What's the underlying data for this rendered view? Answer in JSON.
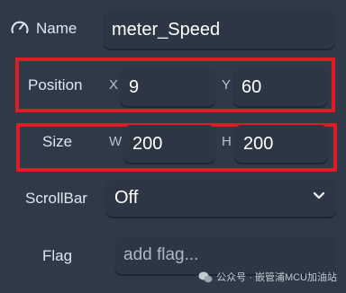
{
  "name": {
    "label": "Name",
    "value": "meter_Speed",
    "icon": "speedometer-icon"
  },
  "position": {
    "label": "Position",
    "x_label": "X",
    "x_value": "9",
    "y_label": "Y",
    "y_value": "60"
  },
  "size": {
    "label": "Size",
    "w_label": "W",
    "w_value": "200",
    "h_label": "H",
    "h_value": "200"
  },
  "scrollbar": {
    "label": "ScrollBar",
    "value": "Off",
    "icon": "chevron-down-icon"
  },
  "flag": {
    "label": "Flag",
    "placeholder": "add flag..."
  },
  "watermark": {
    "text": "公众号 · 嵌管浦MCU加油站",
    "icon": "wechat-icon"
  },
  "colors": {
    "background": "#2f3a48",
    "field": "#2c3644",
    "highlight": "#e01b24"
  }
}
